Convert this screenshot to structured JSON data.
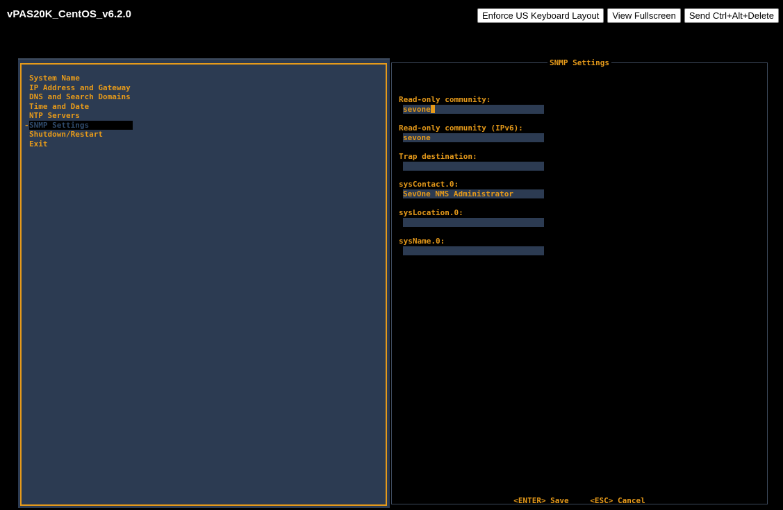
{
  "window": {
    "title": "vPAS20K_CentOS_v6.2.0",
    "buttons": {
      "keyboard": "Enforce US Keyboard Layout",
      "fullscreen": "View Fullscreen",
      "cad": "Send Ctrl+Alt+Delete"
    }
  },
  "menu": {
    "items": [
      {
        "label": "System Name"
      },
      {
        "label": "IP Address and Gateway"
      },
      {
        "label": "DNS and Search Domains"
      },
      {
        "label": "Time and Date"
      },
      {
        "label": "NTP Servers"
      },
      {
        "label": "SNMP Settings",
        "selected": true
      },
      {
        "label": "Shutdown/Restart"
      },
      {
        "label": "Exit"
      }
    ]
  },
  "form": {
    "title": "SNMP Settings",
    "fields": [
      {
        "label": "Read-only community:",
        "value": "sevone"
      },
      {
        "label": "Read-only community (IPv6):",
        "value": "sevone"
      },
      {
        "label": "Trap destination:",
        "value": ""
      },
      {
        "label": "sysContact.0:",
        "value": "SevOne NMS Administrator"
      },
      {
        "label": "sysLocation.0:",
        "value": ""
      },
      {
        "label": "sysName.0:",
        "value": ""
      }
    ],
    "footer": {
      "save": "<ENTER> Save",
      "cancel": "<ESC> Cancel"
    }
  },
  "colors": {
    "background": "#000000",
    "panel": "#2c3b52",
    "accent": "#e69a1a",
    "selected_text": "#2f4a6b"
  }
}
